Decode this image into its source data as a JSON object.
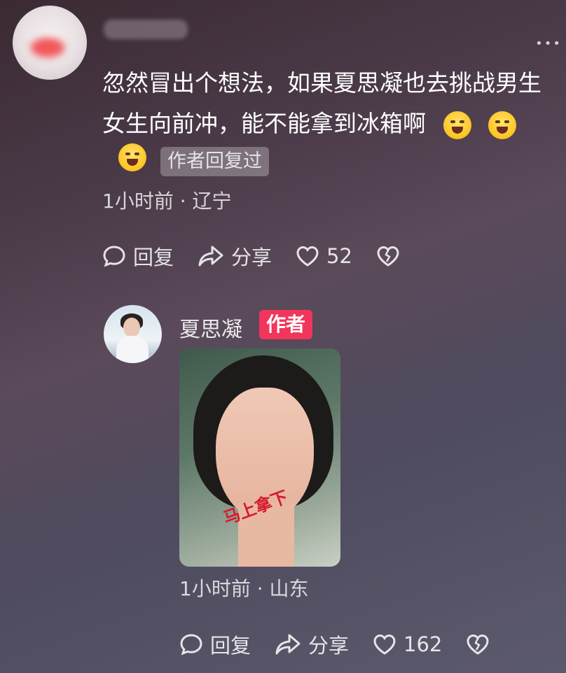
{
  "comment": {
    "text_line1": "忽然冒出个想法，如果夏思凝也去挑战男生",
    "text_line2": "女生向前冲，能不能拿到冰箱啊",
    "author_replied_label": "作者回复过",
    "time": "1小时前",
    "location": "辽宁",
    "reply_label": "回复",
    "share_label": "分享",
    "like_count": "52"
  },
  "reply": {
    "author_name": "夏思凝",
    "author_badge": "作者",
    "time": "1小时前",
    "location": "山东",
    "reply_label": "回复",
    "share_label": "分享",
    "like_count": "162",
    "image_handwriting": "马上拿下"
  },
  "icons": {
    "emoji": "crying-laugh-emoji",
    "comment": "comment-bubble-icon",
    "share": "share-arrow-icon",
    "like": "heart-icon",
    "dislike": "broken-heart-icon",
    "more": "more-dots-icon"
  }
}
